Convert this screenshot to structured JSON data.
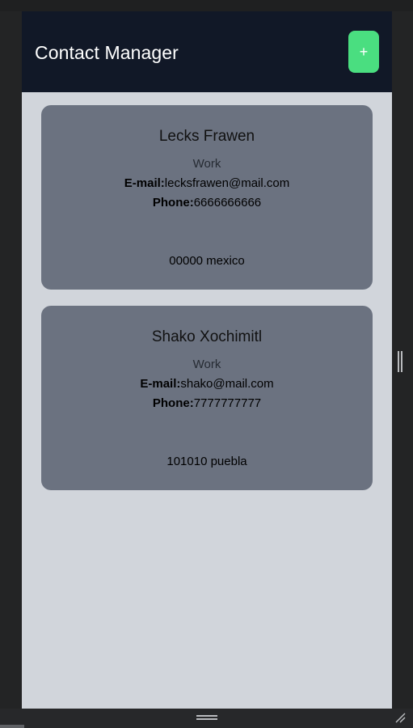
{
  "header": {
    "title": "Contact Manager",
    "add_button_label": "+"
  },
  "contacts": [
    {
      "name": "Lecks Frawen",
      "type": "Work",
      "email_label": "E-mail:",
      "email": "lecksfrawen@mail.com",
      "phone_label": "Phone:",
      "phone": "6666666666",
      "address": "00000 mexico"
    },
    {
      "name": "Shako Xochimitl",
      "type": "Work",
      "email_label": "E-mail:",
      "email": "shako@mail.com",
      "phone_label": "Phone:",
      "phone": "7777777777",
      "address": "101010 puebla"
    }
  ],
  "colors": {
    "header_bg": "#111827",
    "page_bg": "#d1d5db",
    "card_bg": "#6b7280",
    "add_button": "#4ade80"
  },
  "icons": {
    "resize_handle_bottom": "horizontal-grip-icon",
    "resize_handle_side": "vertical-grip-icon",
    "corner_grip": "resize-corner-icon"
  }
}
